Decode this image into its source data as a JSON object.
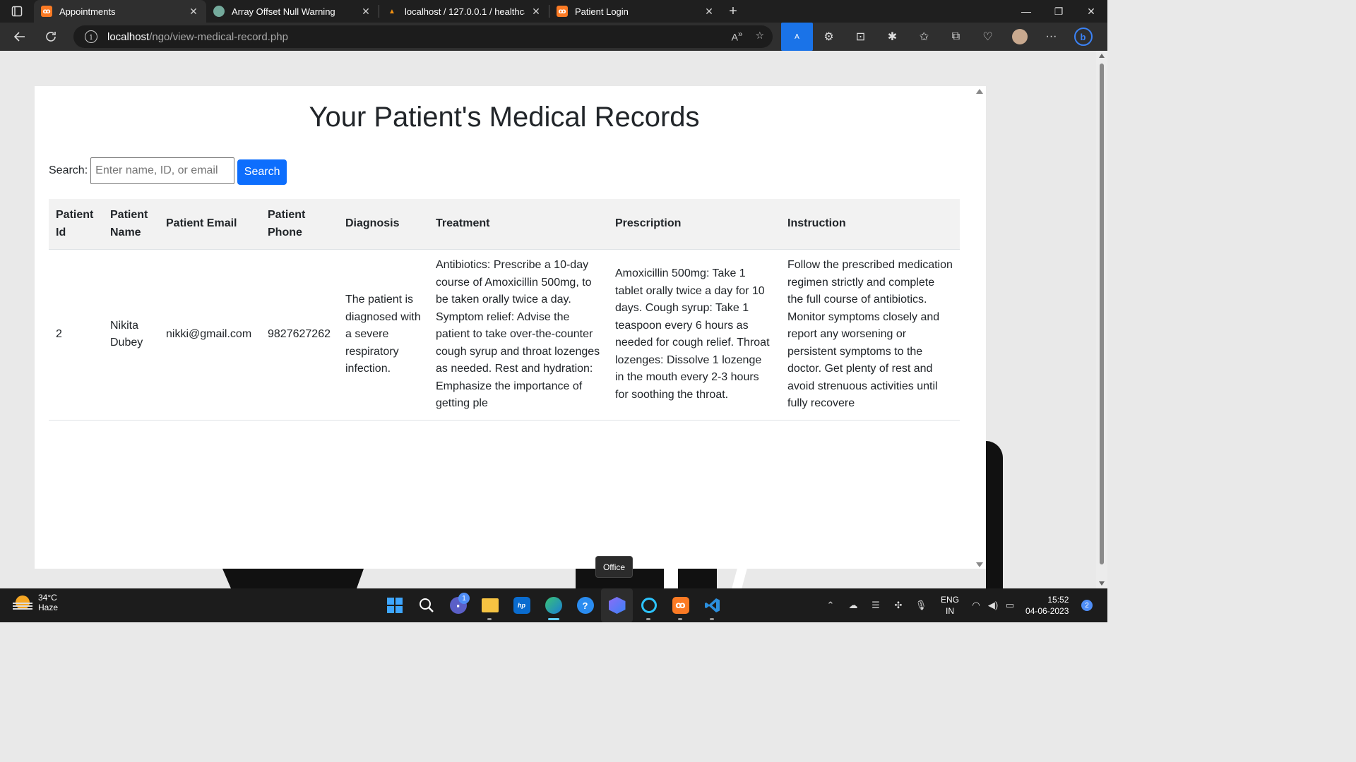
{
  "browser": {
    "tabs": [
      {
        "label": "Appointments",
        "favicon": "xampp-icon",
        "active": true
      },
      {
        "label": "Array Offset Null Warning",
        "favicon": "chatgpt-icon",
        "active": false
      },
      {
        "label": "localhost / 127.0.0.1 / healthcare",
        "favicon": "phpmyadmin-icon",
        "active": false
      },
      {
        "label": "Patient Login",
        "favicon": "xampp-icon",
        "active": false
      }
    ],
    "url_host": "localhost",
    "url_path": "/ngo/view-medical-record.php"
  },
  "page": {
    "title": "Your Patient's Medical Records",
    "search_label": "Search:",
    "search_placeholder": "Enter name, ID, or email",
    "search_value": "",
    "search_button": "Search",
    "columns": [
      "Patient Id",
      "Patient Name",
      "Patient Email",
      "Patient Phone",
      "Diagnosis",
      "Treatment",
      "Prescription",
      "Instruction"
    ],
    "rows": [
      {
        "id": "2",
        "name": "Nikita Dubey",
        "email": "nikki@gmail.com",
        "phone": "9827627262",
        "diagnosis": "The patient is diagnosed with a severe respiratory infection.",
        "treatment": "Antibiotics: Prescribe a 10-day course of Amoxicillin 500mg, to be taken orally twice a day. Symptom relief: Advise the patient to take over-the-counter cough syrup and throat lozenges as needed. Rest and hydration: Emphasize the importance of getting ple",
        "prescription": "Amoxicillin 500mg: Take 1 tablet orally twice a day for 10 days. Cough syrup: Take 1 teaspoon every 6 hours as needed for cough relief. Throat lozenges: Dissolve 1 lozenge in the mouth every 2-3 hours for soothing the throat.",
        "instruction": "Follow the prescribed medication regimen strictly and complete the full course of antibiotics. Monitor symptoms closely and report any worsening or persistent symptoms to the doctor. Get plenty of rest and avoid strenuous activities until fully recovere"
      }
    ]
  },
  "tooltip": "Office",
  "taskbar": {
    "weather_temp": "34°C",
    "weather_desc": "Haze",
    "teams_badge": "1",
    "lang_top": "ENG",
    "lang_bottom": "IN",
    "time": "15:52",
    "date": "04-06-2023",
    "notifications": "2"
  },
  "colors": {
    "primary_button": "#0d6efd",
    "table_header_bg": "#f2f2f2"
  }
}
